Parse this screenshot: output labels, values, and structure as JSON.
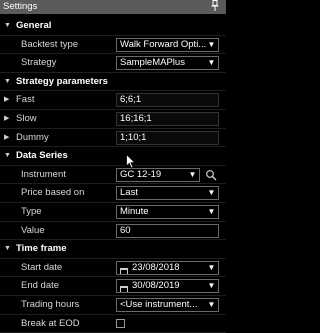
{
  "window": {
    "title": "Settings",
    "pin_icon": "pin-icon"
  },
  "general": {
    "label": "General",
    "backtest_type": {
      "label": "Backtest type",
      "value": "Walk Forward Opti..."
    },
    "strategy": {
      "label": "Strategy",
      "value": "SampleMAPlus"
    }
  },
  "strategy_parameters": {
    "label": "Strategy parameters",
    "fast": {
      "label": "Fast",
      "value": "6;6;1"
    },
    "slow": {
      "label": "Slow",
      "value": "16;16;1"
    },
    "dummy": {
      "label": "Dummy",
      "value": "1;10;1"
    }
  },
  "data_series": {
    "label": "Data Series",
    "instrument": {
      "label": "Instrument",
      "value": "GC 12-19"
    },
    "price_based_on": {
      "label": "Price based on",
      "value": "Last"
    },
    "type": {
      "label": "Type",
      "value": "Minute"
    },
    "value": {
      "label": "Value",
      "value": "60"
    }
  },
  "time_frame": {
    "label": "Time frame",
    "start_date": {
      "label": "Start date",
      "value": "23/08/2018"
    },
    "end_date": {
      "label": "End date",
      "value": "30/08/2019"
    },
    "trading_hours": {
      "label": "Trading hours",
      "value": "<Use instrument..."
    },
    "break_at_eod": {
      "label": "Break at EOD",
      "checked": false
    }
  },
  "colors": {
    "background": "#000000",
    "titlebar": "#5a5a5a",
    "text": "#e8e8e8",
    "field_border": "#6a6a6a"
  }
}
